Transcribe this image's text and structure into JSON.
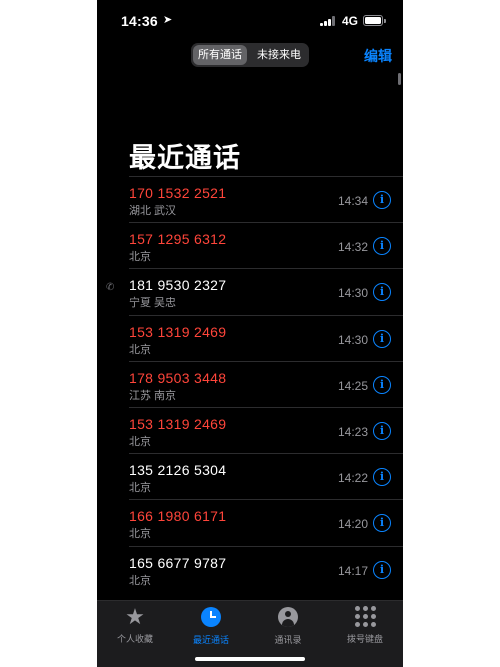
{
  "status": {
    "time": "14:36",
    "network": "4G"
  },
  "segmented": {
    "all": "所有通话",
    "missed": "未接来电"
  },
  "header": {
    "edit": "编辑",
    "title": "最近通话"
  },
  "calls": [
    {
      "number": "170 1532 2521",
      "location": "湖北 武汉",
      "time": "14:34",
      "missed": true
    },
    {
      "number": "157 1295 6312",
      "location": "北京",
      "time": "14:32",
      "missed": true
    },
    {
      "number": "181 9530 2327",
      "location": "宁夏 吴忠",
      "time": "14:30",
      "missed": false
    },
    {
      "number": "153 1319 2469",
      "location": "北京",
      "time": "14:30",
      "missed": true
    },
    {
      "number": "178 9503 3448",
      "location": "江苏 南京",
      "time": "14:25",
      "missed": true
    },
    {
      "number": "153 1319 2469",
      "location": "北京",
      "time": "14:23",
      "missed": true
    },
    {
      "number": "135 2126 5304",
      "location": "北京",
      "time": "14:22",
      "missed": false
    },
    {
      "number": "166 1980 6171",
      "location": "北京",
      "time": "14:20",
      "missed": true
    },
    {
      "number": "165 6677 9787",
      "location": "北京",
      "time": "14:17",
      "missed": false
    }
  ],
  "tabs": [
    {
      "label": "个人收藏",
      "icon": "star-icon"
    },
    {
      "label": "最近通话",
      "icon": "clock-icon"
    },
    {
      "label": "通讯录",
      "icon": "person-icon"
    },
    {
      "label": "拨号键盘",
      "icon": "keypad-icon"
    }
  ],
  "colors": {
    "missed": "#ff453a",
    "accent": "#0a84ff"
  }
}
